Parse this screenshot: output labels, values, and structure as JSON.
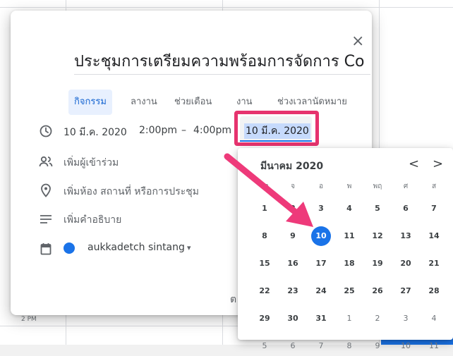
{
  "dialog": {
    "close_glyph": "×",
    "title": "ประชุมการเตรียมความพร้อมการจัดการ Co",
    "tabs": [
      {
        "label": "กิจกรรม",
        "active": true
      },
      {
        "label": "ลางาน",
        "active": false
      },
      {
        "label": "ช่วยเตือน",
        "active": false
      },
      {
        "label": "งาน",
        "active": false
      },
      {
        "label": "ช่วงเวลานัดหมาย",
        "active": false
      }
    ],
    "date_time": {
      "start_date": "10 มี.ค. 2020",
      "start_time": "2:00pm",
      "dash": "–",
      "end_time": "4:00pm",
      "end_date": "10 มี.ค. 2020"
    },
    "rows": {
      "guests": "เพิ่มผู้เข้าร่วม",
      "location": "เพิ่มห้อง สถานที่ หรือการประชุม",
      "description": "เพิ่มคำอธิบาย"
    },
    "owner": "aukkadetch sintang",
    "owner_caret": "▾",
    "more_cutoff": "ต"
  },
  "date_picker": {
    "month_label": "มีนาคม 2020",
    "prev_glyph": "<",
    "next_glyph": ">",
    "weekdays": [
      "อา",
      "จ",
      "อ",
      "พ",
      "พฤ",
      "ศ",
      "ส"
    ],
    "weeks": [
      [
        "1",
        "2",
        "3",
        "4",
        "5",
        "6",
        "7"
      ],
      [
        "8",
        "9",
        "10",
        "11",
        "12",
        "13",
        "14"
      ],
      [
        "15",
        "16",
        "17",
        "18",
        "19",
        "20",
        "21"
      ],
      [
        "22",
        "23",
        "24",
        "25",
        "26",
        "27",
        "28"
      ],
      [
        "29",
        "30",
        "31",
        "1",
        "2",
        "3",
        "4"
      ],
      [
        "5",
        "6",
        "7",
        "8",
        "9",
        "10",
        "11"
      ]
    ],
    "selected": "10"
  },
  "background": {
    "time_label": "2 PM"
  },
  "colors": {
    "accent": "#1a73e8",
    "highlight": "#e6336e",
    "arrow": "#ee3a7a"
  }
}
